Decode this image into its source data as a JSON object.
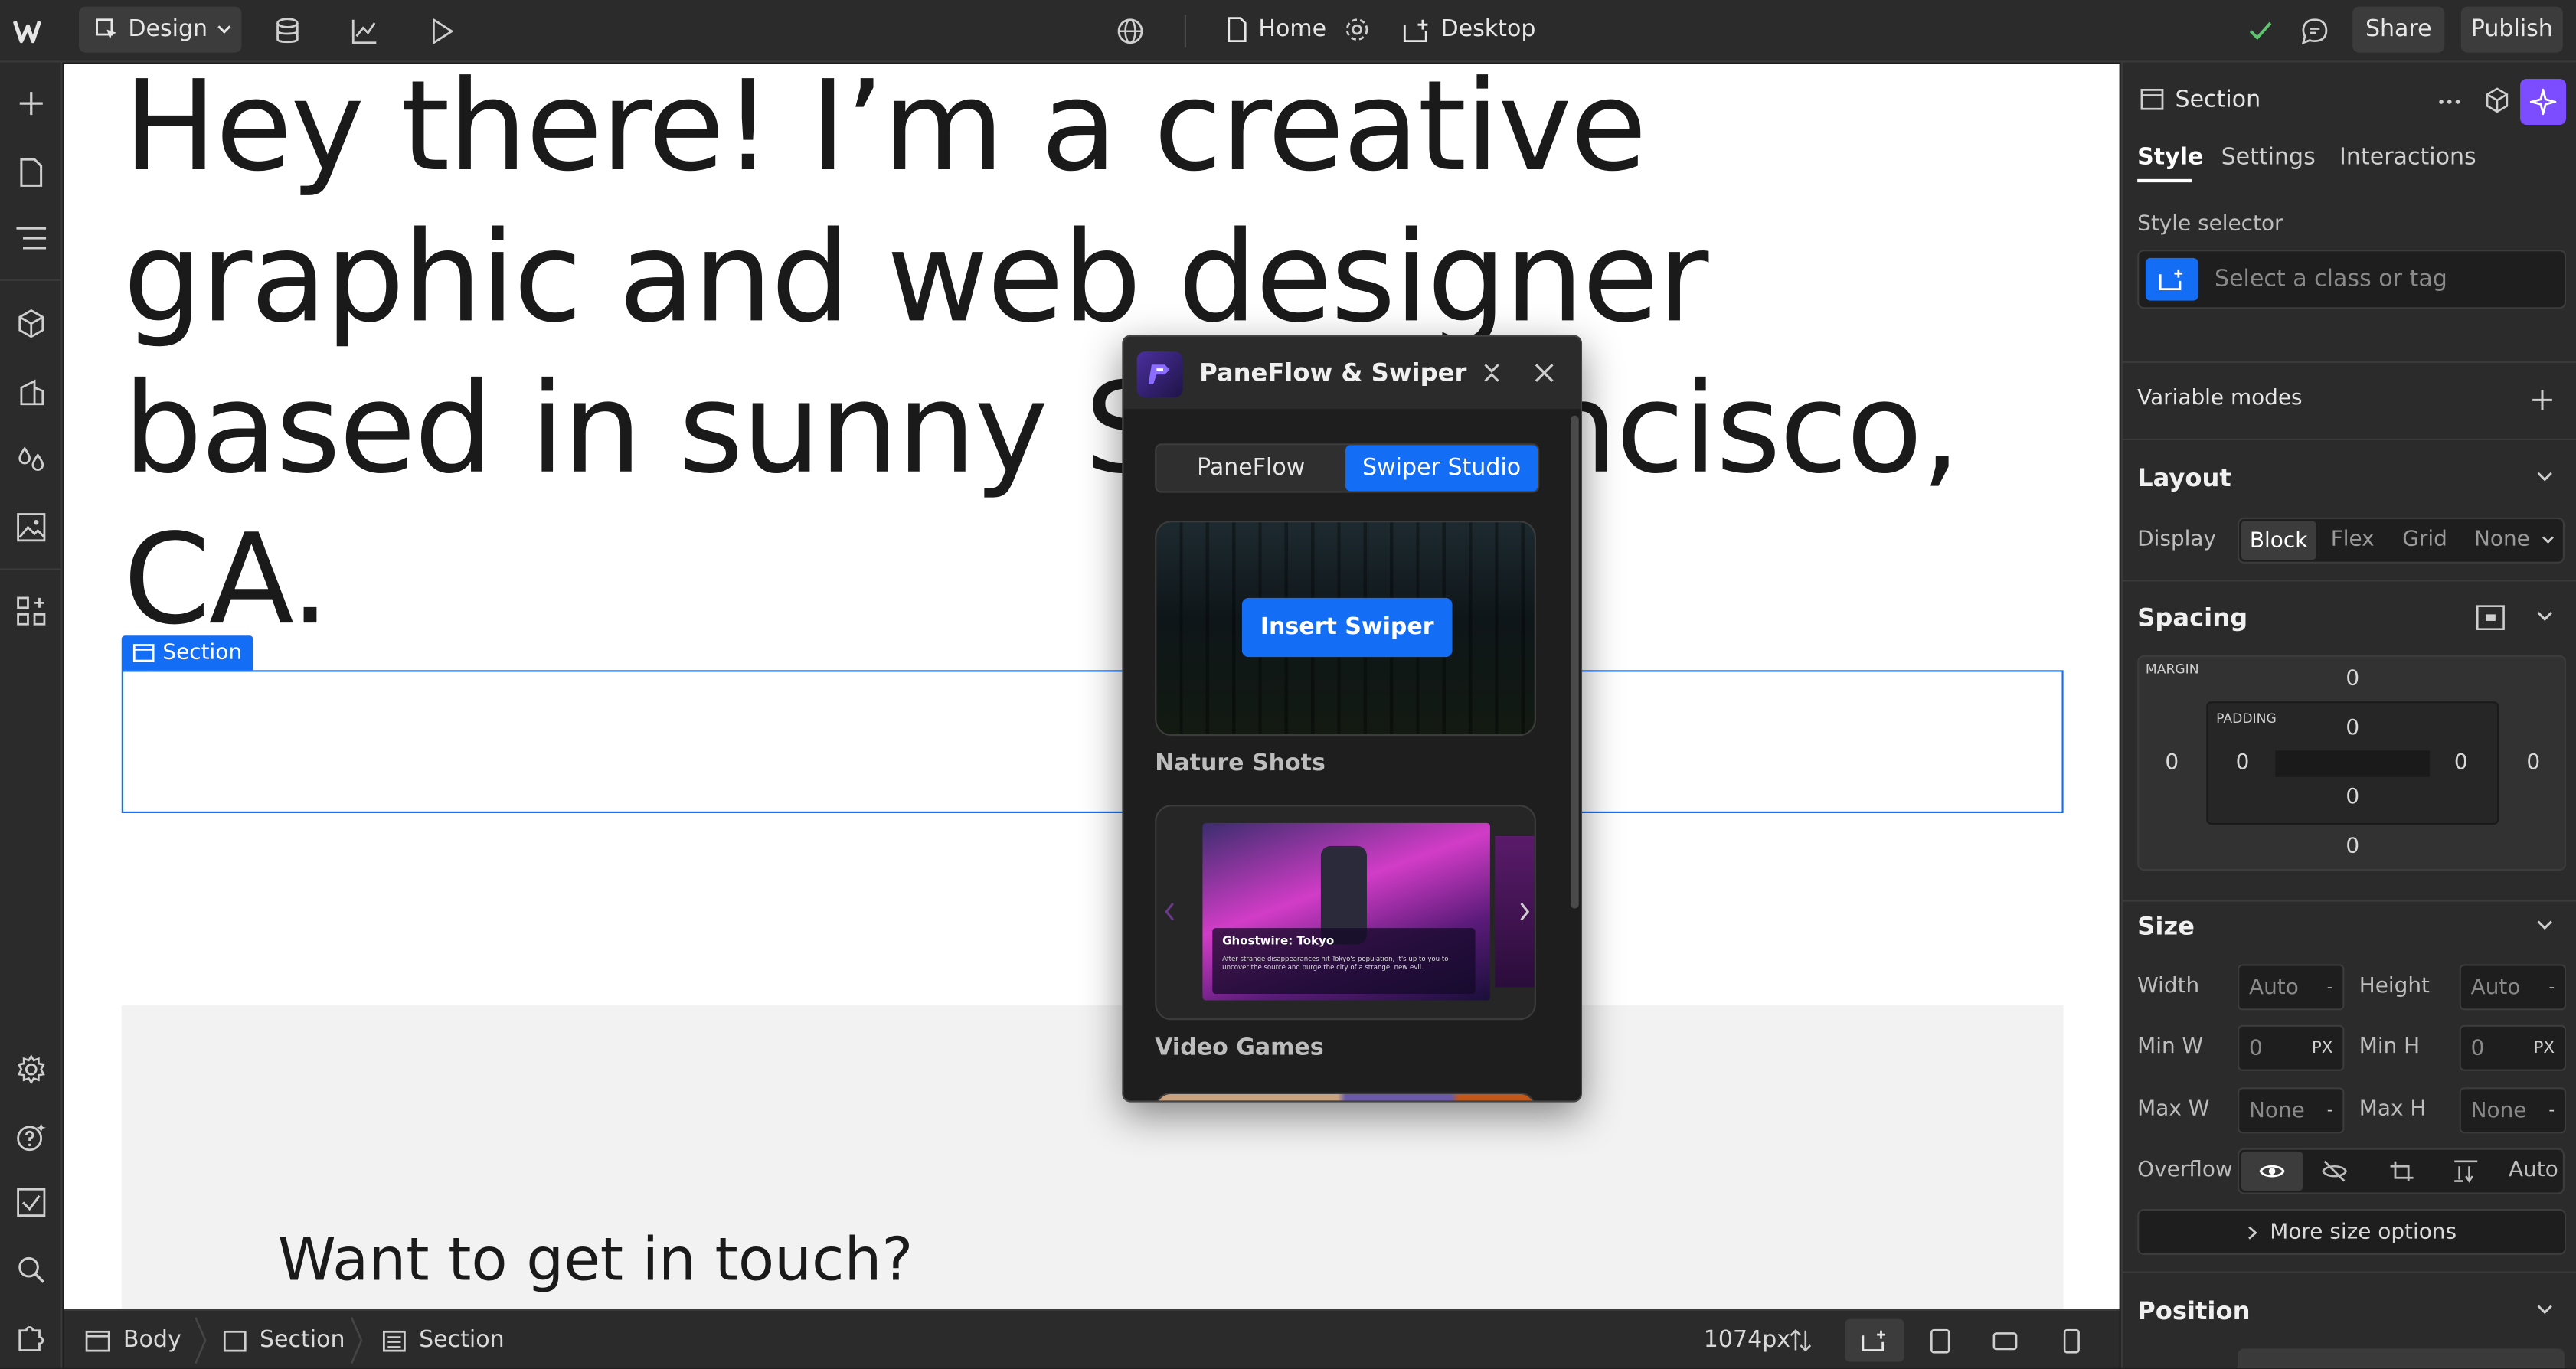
{
  "topbar": {
    "mode_label": "Design",
    "page_label": "Home",
    "breakpoint_label": "Desktop",
    "share_label": "Share",
    "publish_label": "Publish"
  },
  "canvas": {
    "hero_line1": "Hey there! I’m a creative",
    "hero_line2": "graphic and web designer",
    "hero_line3": "based in sunny San Francisco,",
    "hero_line4": "CA.",
    "selected_label": "Section",
    "contact_heading": "Want to get in touch?"
  },
  "panel": {
    "title": "PaneFlow & Swiper",
    "tabs": [
      "PaneFlow",
      "Swiper Studio"
    ],
    "active_tab": "Swiper Studio",
    "insert_label": "Insert Swiper",
    "cards": [
      {
        "label": "Nature Shots"
      },
      {
        "label": "Video Games",
        "slide_title": "Ghostwire: Tokyo",
        "slide_text": "After strange disappearances hit Tokyo's population, it's up to you to uncover the source and purge the city of a strange, new evil."
      }
    ]
  },
  "rpanel": {
    "element_label": "Section",
    "tabs": [
      "Style",
      "Settings",
      "Interactions"
    ],
    "active_tab": "Style",
    "style_selector_label": "Style selector",
    "style_selector_placeholder": "Select a class or tag",
    "variable_modes_label": "Variable modes",
    "layout": {
      "heading": "Layout",
      "display_label": "Display",
      "options": [
        "Block",
        "Flex",
        "Grid",
        "None"
      ],
      "active": "Block"
    },
    "spacing": {
      "heading": "Spacing",
      "margin_label": "MARGIN",
      "padding_label": "PADDING",
      "margin": {
        "top": "0",
        "right": "0",
        "bottom": "0",
        "left": "0"
      },
      "padding": {
        "top": "0",
        "right": "0",
        "bottom": "0",
        "left": "0"
      }
    },
    "size": {
      "heading": "Size",
      "width_label": "Width",
      "width_value": "Auto",
      "width_unit": "-",
      "height_label": "Height",
      "height_value": "Auto",
      "height_unit": "-",
      "minw_label": "Min W",
      "minw_value": "0",
      "minw_unit": "PX",
      "minh_label": "Min H",
      "minh_value": "0",
      "minh_unit": "PX",
      "maxw_label": "Max W",
      "maxw_value": "None",
      "maxw_unit": "-",
      "maxh_label": "Max H",
      "maxh_value": "None",
      "maxh_unit": "-",
      "overflow_label": "Overflow",
      "overflow_auto": "Auto",
      "more_label": "More size options"
    },
    "position": {
      "heading": "Position"
    }
  },
  "bottombar": {
    "crumbs": [
      "Body",
      "Section",
      "Section"
    ],
    "width_readout": "1074px"
  },
  "colors": {
    "accent": "#146ef5",
    "publish_bg": "#3c3c3c"
  }
}
